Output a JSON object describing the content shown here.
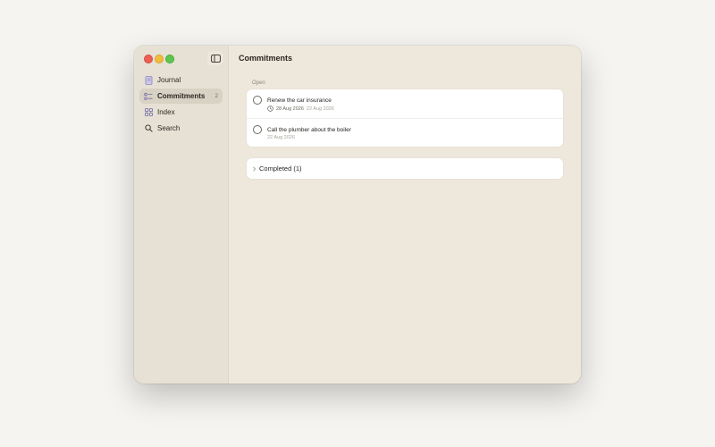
{
  "window": {
    "title": "Commitments"
  },
  "sidebar": {
    "toggle_icon": "sidebar-toggle-icon",
    "items": [
      {
        "label": "Journal",
        "icon": "notebook-icon",
        "count": "",
        "active": false
      },
      {
        "label": "Commitments",
        "icon": "checklist-icon",
        "count": "2",
        "active": true
      },
      {
        "label": "Index",
        "icon": "grid-icon",
        "count": "",
        "active": false
      },
      {
        "label": "Search",
        "icon": "search-icon",
        "count": "",
        "active": false
      }
    ]
  },
  "main": {
    "section_label": "Open",
    "open_items": [
      {
        "title": "Renew the car insurance",
        "due_date": "28 Aug 2026",
        "created_date": "22 Aug 2026",
        "has_due": true
      },
      {
        "title": "Call the plumber about the boiler",
        "due_date": "",
        "created_date": "22 Aug 2026",
        "has_due": false
      }
    ],
    "completed_label": "Completed (1)"
  },
  "colors": {
    "window_bg": "#ede8db",
    "sidebar_bg": "#e6e1d4",
    "active_item_bg": "#d8d2c4",
    "card_bg": "#ffffff",
    "close": "#ec5f57",
    "minimize": "#f2bd3d",
    "zoom": "#5fc550"
  }
}
